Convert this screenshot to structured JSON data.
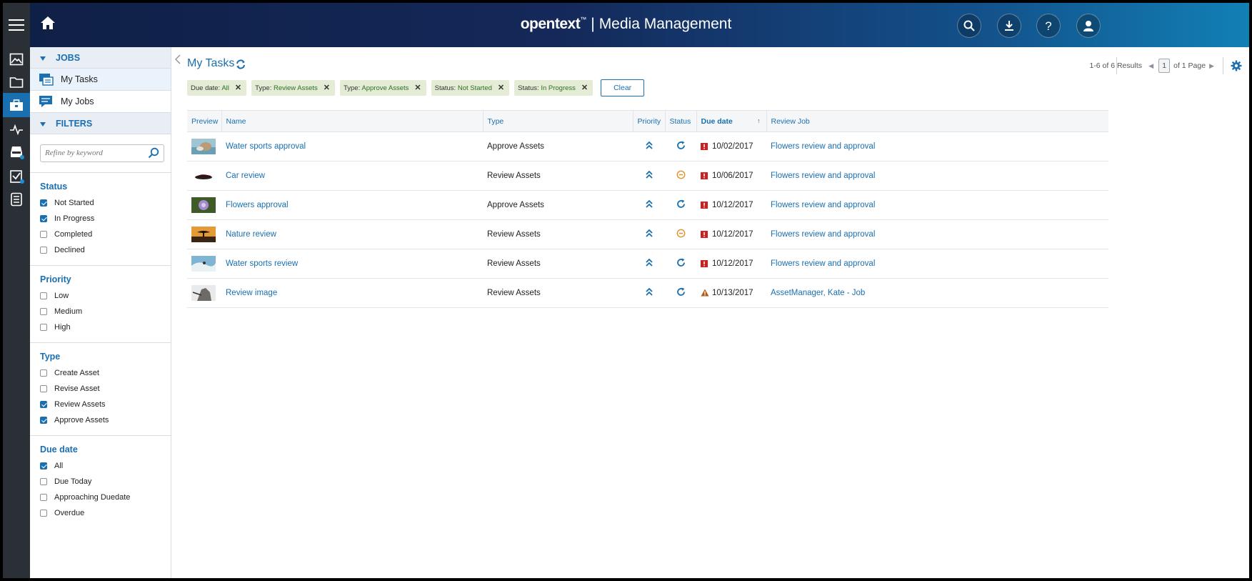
{
  "header": {
    "brand_name": "opentext",
    "brand_tm": "™",
    "brand_sep": "|",
    "product": "Media Management"
  },
  "jobs_section": {
    "title": "JOBS",
    "items": [
      {
        "label": "My Tasks",
        "selected": true
      },
      {
        "label": "My Jobs",
        "selected": false
      }
    ]
  },
  "filters_section": {
    "title": "FILTERS",
    "search_placeholder": "Refine by keyword",
    "groups": [
      {
        "title": "Status",
        "options": [
          {
            "label": "Not Started",
            "checked": true
          },
          {
            "label": "In Progress",
            "checked": true
          },
          {
            "label": "Completed",
            "checked": false
          },
          {
            "label": "Declined",
            "checked": false
          }
        ]
      },
      {
        "title": "Priority",
        "options": [
          {
            "label": "Low",
            "checked": false
          },
          {
            "label": "Medium",
            "checked": false
          },
          {
            "label": "High",
            "checked": false
          }
        ]
      },
      {
        "title": "Type",
        "options": [
          {
            "label": "Create Asset",
            "checked": false
          },
          {
            "label": "Revise Asset",
            "checked": false
          },
          {
            "label": "Review Assets",
            "checked": true
          },
          {
            "label": "Approve Assets",
            "checked": true
          }
        ]
      },
      {
        "title": "Due date",
        "options": [
          {
            "label": "All",
            "checked": true
          },
          {
            "label": "Due Today",
            "checked": false
          },
          {
            "label": "Approaching Duedate",
            "checked": false
          },
          {
            "label": "Overdue",
            "checked": false
          }
        ]
      }
    ]
  },
  "main": {
    "title": "My Tasks",
    "results_text": "1-6 of 6 Results",
    "page_current": "1",
    "page_total_text": "of 1 Page",
    "chips": [
      {
        "key": "Due date:",
        "value": "All"
      },
      {
        "key": "Type:",
        "value": "Review Assets"
      },
      {
        "key": "Type:",
        "value": "Approve Assets"
      },
      {
        "key": "Status:",
        "value": "Not Started"
      },
      {
        "key": "Status:",
        "value": "In Progress"
      }
    ],
    "clear_label": "Clear",
    "columns": {
      "preview": "Preview",
      "name": "Name",
      "type": "Type",
      "priority": "Priority",
      "status": "Status",
      "due_date": "Due date",
      "review_job": "Review Job"
    },
    "rows": [
      {
        "name": "Water sports approval",
        "type": "Approve Assets",
        "status": "in-progress",
        "due_flag": "overdue",
        "due_date": "10/02/2017",
        "review_job": "Flowers review and approval",
        "thumb": "water"
      },
      {
        "name": "Car review",
        "type": "Review Assets",
        "status": "not-started",
        "due_flag": "overdue",
        "due_date": "10/06/2017",
        "review_job": "Flowers review and approval",
        "thumb": "car"
      },
      {
        "name": "Flowers approval",
        "type": "Approve Assets",
        "status": "in-progress",
        "due_flag": "overdue",
        "due_date": "10/12/2017",
        "review_job": "Flowers review and approval",
        "thumb": "flower"
      },
      {
        "name": "Nature review",
        "type": "Review Assets",
        "status": "not-started",
        "due_flag": "overdue",
        "due_date": "10/12/2017",
        "review_job": "Flowers review and approval",
        "thumb": "sunset"
      },
      {
        "name": "Water sports review",
        "type": "Review Assets",
        "status": "in-progress",
        "due_flag": "overdue",
        "due_date": "10/12/2017",
        "review_job": "Flowers review and approval",
        "thumb": "wave"
      },
      {
        "name": "Review image",
        "type": "Review Assets",
        "status": "in-progress",
        "due_flag": "warning",
        "due_date": "10/13/2017",
        "review_job": "AssetManager, Kate - Job",
        "thumb": "rock"
      }
    ]
  },
  "colors": {
    "accent": "#1a6fb0",
    "overdue": "#cc1f1f",
    "warning": "#b35b12",
    "not_started": "#e0922a"
  }
}
